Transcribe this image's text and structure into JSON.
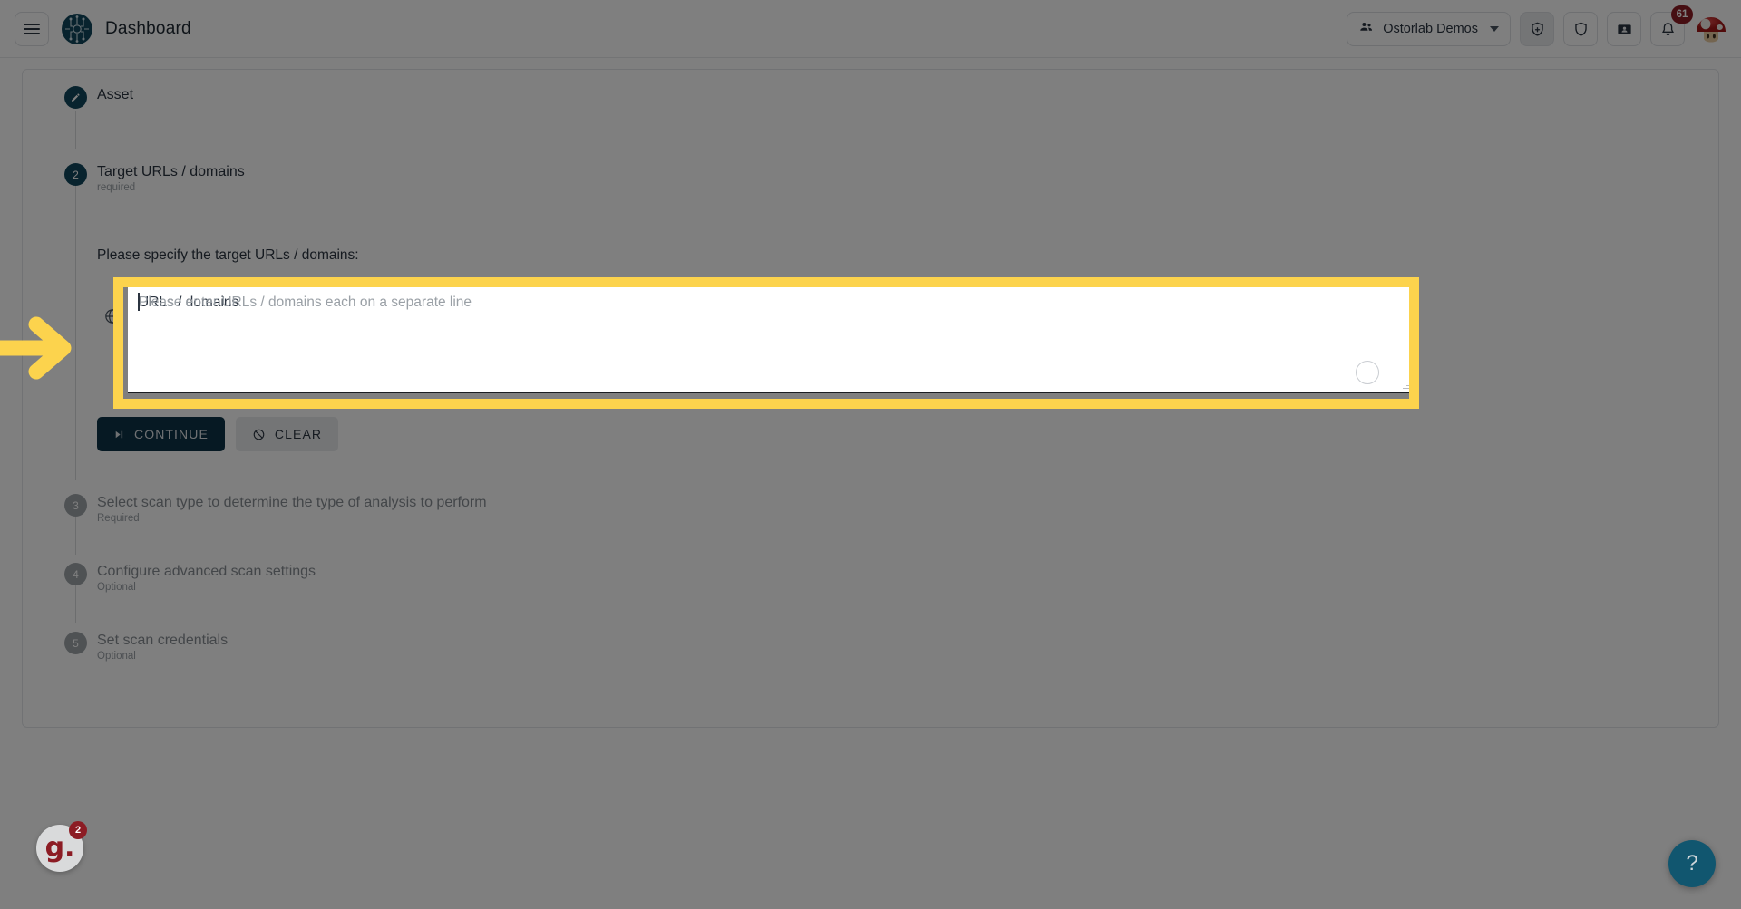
{
  "header": {
    "menu_icon": "hamburger-menu-icon",
    "logo_icon": "ostorlab-circuit-logo",
    "title": "Dashboard",
    "org_selector": {
      "icon": "group-people-icon",
      "label": "Ostorlab Demos",
      "chevron": "chevron-down-icon"
    },
    "actions": [
      {
        "icon": "shield-add-icon",
        "name": "new-scan-button",
        "active": true
      },
      {
        "icon": "shield-icon",
        "name": "security-button",
        "active": false
      },
      {
        "icon": "id-card-icon",
        "name": "tickets-button",
        "active": false
      },
      {
        "icon": "bell-icon",
        "name": "notifications-button",
        "active": false,
        "badge": "61"
      }
    ],
    "avatar": "mushroom-avatar"
  },
  "wizard": {
    "steps": [
      {
        "index": "1",
        "label": "Asset",
        "sub": "",
        "state": "done",
        "icon": "pencil-edit-icon"
      },
      {
        "index": "2",
        "label": "Target URLs / domains",
        "sub": "required",
        "state": "active"
      },
      {
        "index": "3",
        "label": "Select scan type to determine the type of analysis to perform",
        "sub": "Required",
        "state": "idle"
      },
      {
        "index": "4",
        "label": "Configure advanced scan settings",
        "sub": "Optional",
        "state": "idle"
      },
      {
        "index": "5",
        "label": "Set scan credentials",
        "sub": "Optional",
        "state": "idle"
      }
    ],
    "step2": {
      "prompt": "Please specify the target URLs / domains:",
      "field_icon": "globe-icon",
      "field_label": "URLs / domains",
      "field_value": "",
      "field_placeholder": "Please enter URLs / domains each on a separate line",
      "drop_indicator": "circle-drop-indicator",
      "buttons": {
        "continue": {
          "label": "CONTINUE",
          "icon": "skip-next-icon"
        },
        "clear": {
          "label": "CLEAR",
          "icon": "block-circle-slash-icon"
        }
      }
    }
  },
  "annotation": {
    "arrow": "yellow-right-arrow",
    "arrow_color": "#FCD34D",
    "highlight_color": "#FCD34D"
  },
  "widgets": {
    "guide": {
      "icon": "g-logo",
      "letter": "g.",
      "badge": "2"
    },
    "help": {
      "icon": "question-mark-icon",
      "label": "?"
    }
  },
  "colors": {
    "brand_dark": "#11475c",
    "primary_button": "#0c3347",
    "badge_red": "#8c1c24",
    "highlight_yellow": "#FCD34D"
  }
}
